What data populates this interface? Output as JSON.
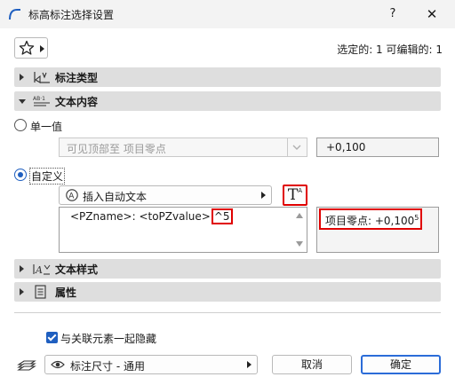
{
  "window": {
    "title": "标高标注选择设置",
    "help": "?",
    "close": "✕"
  },
  "selection_info": "选定的: 1 可编辑的: 1",
  "sections": {
    "marker_type": "标注类型",
    "text_content": "文本内容",
    "text_style": "文本样式",
    "properties": "属性"
  },
  "text_content": {
    "single_value_label": "单一值",
    "single_value_select": "可见顶部至 项目零点",
    "single_value_result": "+0,100",
    "custom_label": "自定义",
    "insert_auto_text": "插入自动文本",
    "format_button": "T",
    "format_button_sup": "A",
    "editor_text": "<PZname>: <toPZvalue>",
    "editor_highlight": "^5",
    "preview_text": "项目零点: +0,100",
    "preview_sup": "5"
  },
  "hide_with_element": {
    "label": "与关联元素一起隐藏",
    "checked": true
  },
  "footer": {
    "layer_select": "标注尺寸 - 通用",
    "cancel": "取消",
    "ok": "确定"
  },
  "colors": {
    "accent": "#1f5fc0",
    "highlight": "#e00000",
    "section_bg": "#dedede"
  }
}
